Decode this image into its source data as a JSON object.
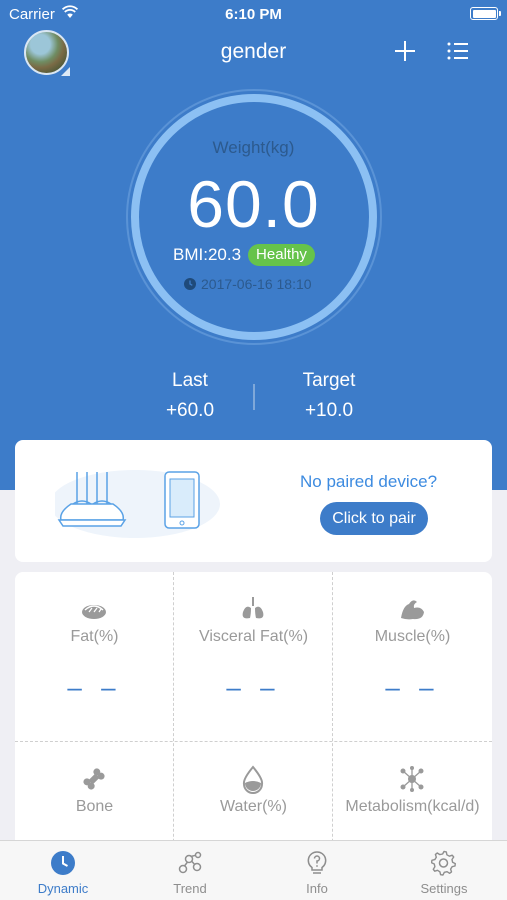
{
  "status_bar": {
    "carrier": "Carrier",
    "time": "6:10 PM"
  },
  "nav": {
    "title": "gender"
  },
  "gauge": {
    "label": "Weight(kg)",
    "value": "60.0",
    "bmi": "BMI:20.3",
    "status": "Healthy",
    "date": "2017-06-16 18:10"
  },
  "stats": {
    "last_label": "Last",
    "last_value": "+60.0",
    "target_label": "Target",
    "target_value": "+10.0"
  },
  "pair": {
    "question": "No paired device?",
    "button": "Click to pair"
  },
  "metrics": [
    {
      "icon": "fat-icon",
      "label": "Fat(%)",
      "value": "– –"
    },
    {
      "icon": "lungs-icon",
      "label": "Visceral Fat(%)",
      "value": "– –"
    },
    {
      "icon": "muscle-icon",
      "label": "Muscle(%)",
      "value": "– –"
    },
    {
      "icon": "bone-icon",
      "label": "Bone",
      "value": ""
    },
    {
      "icon": "water-drop-icon",
      "label": "Water(%)",
      "value": ""
    },
    {
      "icon": "metabolism-icon",
      "label": "Metabolism(kcal/d)",
      "value": ""
    }
  ],
  "tabs": [
    {
      "icon": "clock-icon",
      "label": "Dynamic",
      "active": true
    },
    {
      "icon": "trend-icon",
      "label": "Trend",
      "active": false
    },
    {
      "icon": "info-bulb-icon",
      "label": "Info",
      "active": false
    },
    {
      "icon": "gear-icon",
      "label": "Settings",
      "active": false
    }
  ],
  "colors": {
    "primary": "#3d7cc9",
    "healthy": "#66c34b",
    "link": "#3d8be0"
  }
}
